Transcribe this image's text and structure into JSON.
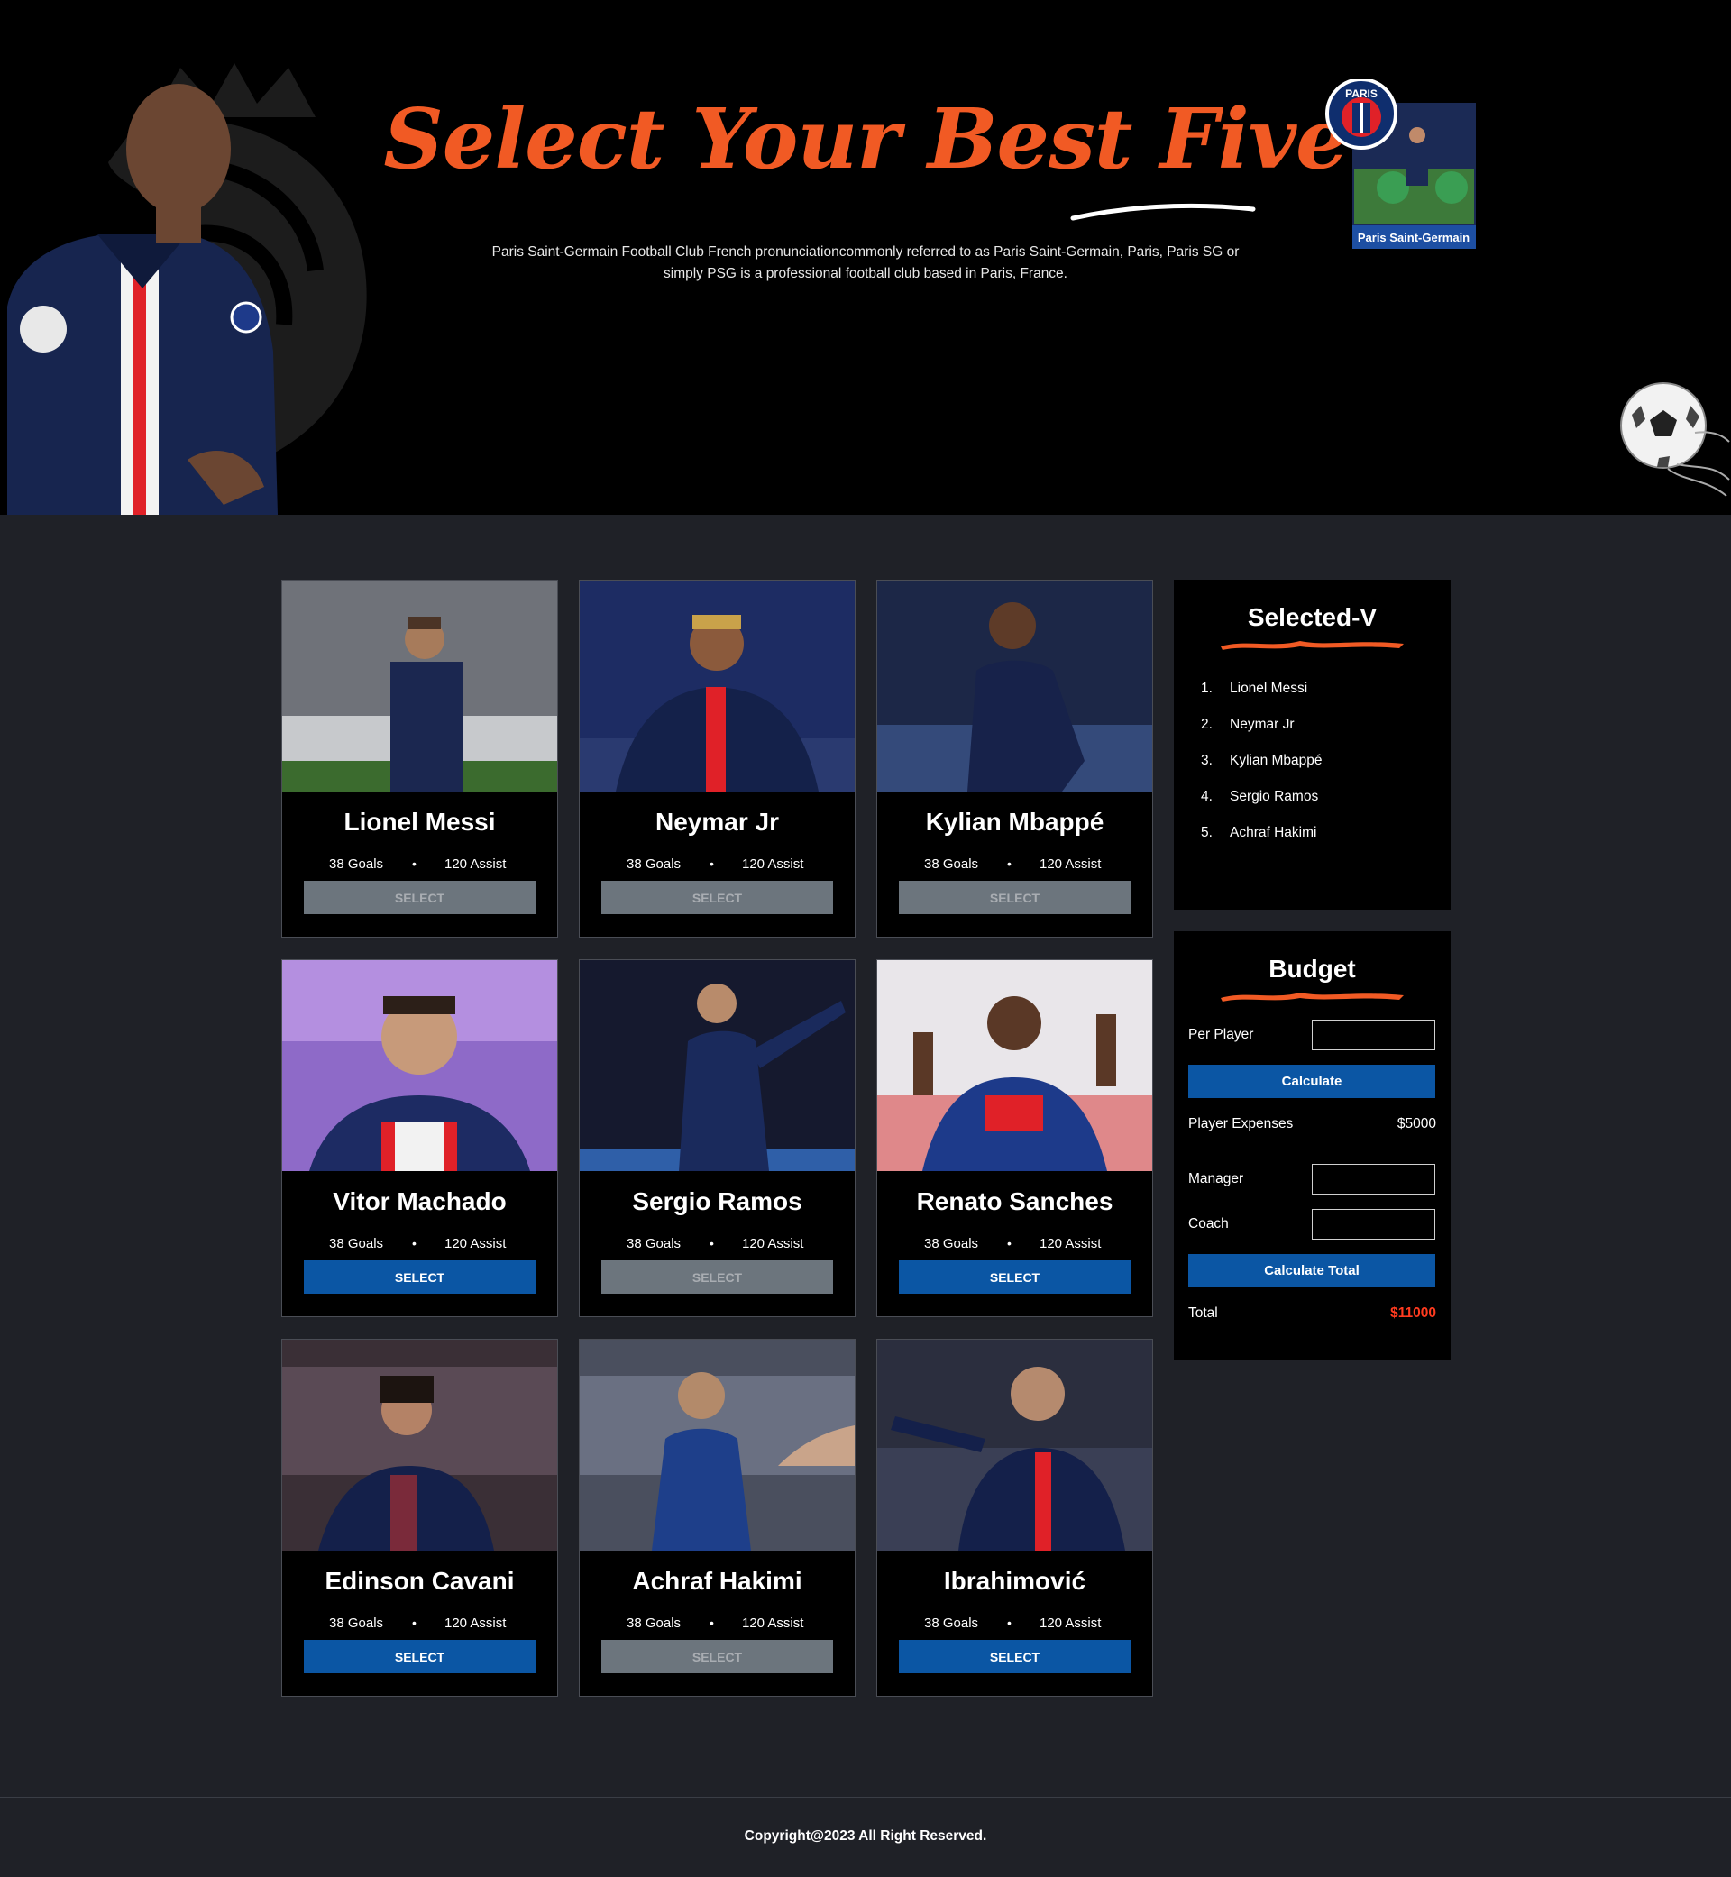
{
  "hero": {
    "title": "Select Your Best Five",
    "description": "Paris Saint-Germain Football Club French pronunciationcommonly referred to as Paris Saint-Germain, Paris, Paris SG or simply PSG is a professional football club based in Paris, France.",
    "badge_caption": "Paris Saint-Germain",
    "badge_logo_text": "PARIS"
  },
  "colors": {
    "accent": "#f15a24",
    "button_blue": "#0b56a4",
    "button_disabled": "#6c757d",
    "page_bg": "#1f2127",
    "total_red": "#ff3b1f"
  },
  "players": [
    {
      "name": "Lionel Messi",
      "goals": "38 Goals",
      "assist": "120 Assist",
      "button": "SELECT",
      "selected": true
    },
    {
      "name": "Neymar Jr",
      "goals": "38 Goals",
      "assist": "120 Assist",
      "button": "SELECT",
      "selected": true
    },
    {
      "name": "Kylian Mbappé",
      "goals": "38 Goals",
      "assist": "120 Assist",
      "button": "SELECT",
      "selected": true
    },
    {
      "name": "Vitor Machado",
      "goals": "38 Goals",
      "assist": "120 Assist",
      "button": "SELECT",
      "selected": false
    },
    {
      "name": "Sergio Ramos",
      "goals": "38 Goals",
      "assist": "120 Assist",
      "button": "SELECT",
      "selected": true
    },
    {
      "name": "Renato Sanches",
      "goals": "38 Goals",
      "assist": "120 Assist",
      "button": "SELECT",
      "selected": false
    },
    {
      "name": "Edinson Cavani",
      "goals": "38 Goals",
      "assist": "120 Assist",
      "button": "SELECT",
      "selected": false
    },
    {
      "name": "Achraf Hakimi",
      "goals": "38 Goals",
      "assist": "120 Assist",
      "button": "SELECT",
      "selected": true
    },
    {
      "name": "Ibrahimović",
      "goals": "38 Goals",
      "assist": "120 Assist",
      "button": "SELECT",
      "selected": false
    }
  ],
  "selected_panel": {
    "title": "Selected-V",
    "items": [
      {
        "num": "1.",
        "name": "Lionel Messi"
      },
      {
        "num": "2.",
        "name": "Neymar Jr"
      },
      {
        "num": "3.",
        "name": "Kylian Mbappé"
      },
      {
        "num": "4.",
        "name": "Sergio Ramos"
      },
      {
        "num": "5.",
        "name": "Achraf Hakimi"
      }
    ]
  },
  "budget": {
    "title": "Budget",
    "per_player_label": "Per Player",
    "per_player_value": "",
    "calculate_label": "Calculate",
    "player_expenses_label": "Player Expenses",
    "player_expenses_value": "$5000",
    "manager_label": "Manager",
    "manager_value": "",
    "coach_label": "Coach",
    "coach_value": "",
    "calculate_total_label": "Calculate Total",
    "total_label": "Total",
    "total_value": "$11000"
  },
  "footer": {
    "copyright": "Copyright@2023 All Right Reserved."
  }
}
